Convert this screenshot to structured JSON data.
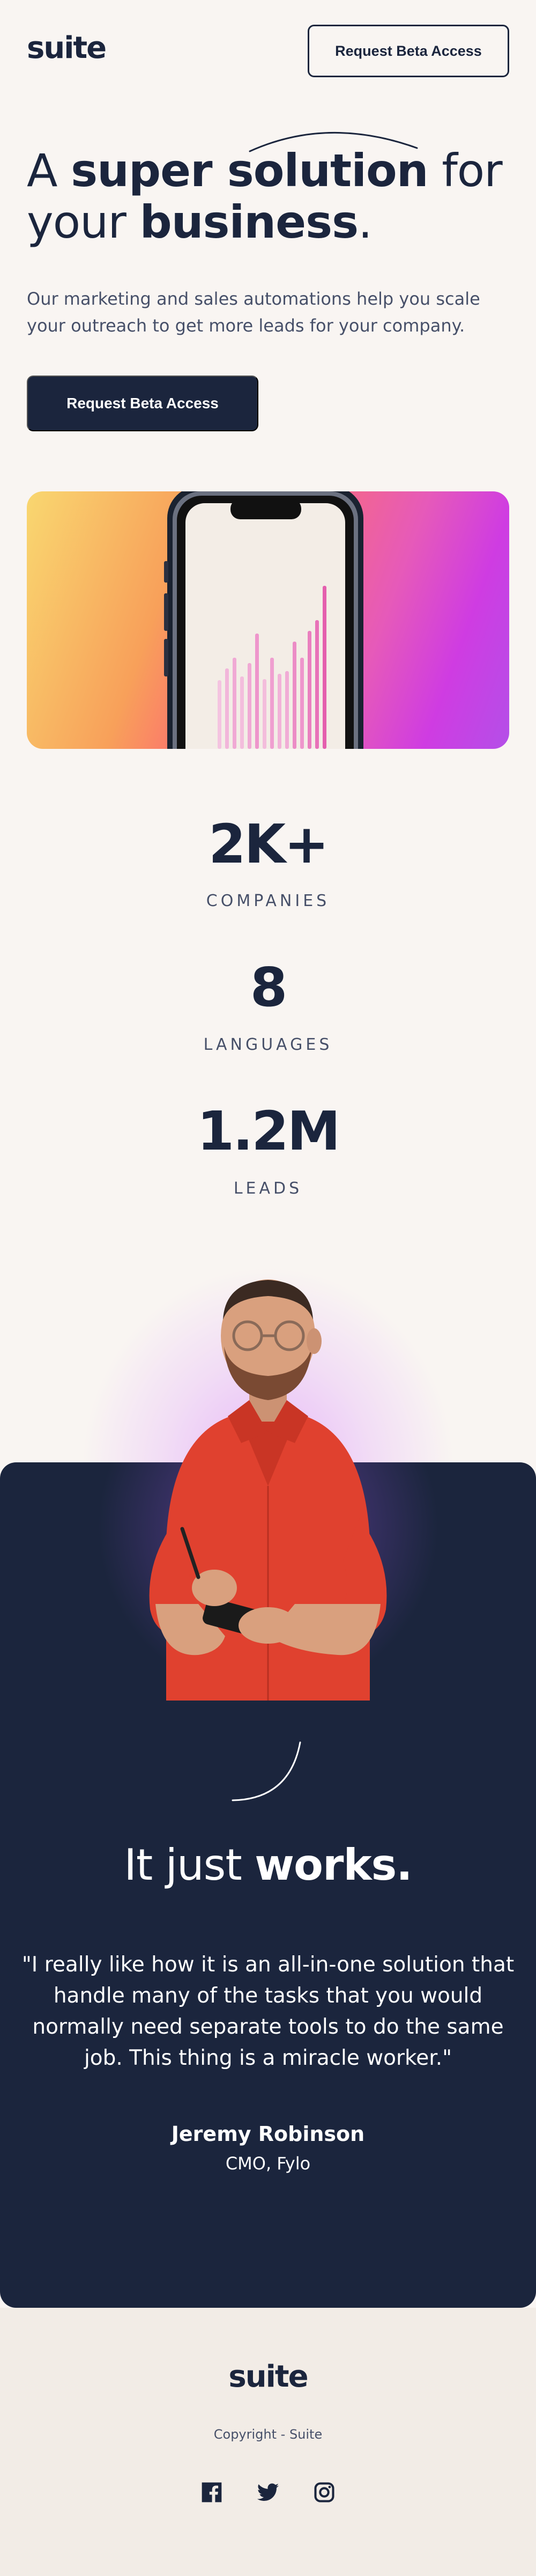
{
  "header": {
    "logo": "suite",
    "cta_label": "Request Beta Access"
  },
  "hero": {
    "title_part1": "A ",
    "title_bold1": "super solution",
    "title_part2": " for your ",
    "title_bold2": "business",
    "title_part3": ".",
    "subtitle": "Our marketing and sales automations help you scale your outreach to get more leads for your company.",
    "cta_label": "Request Beta Access"
  },
  "stats": [
    {
      "value": "2K+",
      "label": "COMPANIES"
    },
    {
      "value": "8",
      "label": "LANGUAGES"
    },
    {
      "value": "1.2M",
      "label": "LEADS"
    }
  ],
  "testimonial": {
    "heading_part1": "It just ",
    "heading_bold": "works.",
    "quote": "\"I really like how it is an all-in-one solution that handle many of the tasks that you would normally need separate tools to do the same job. This thing is a miracle worker.\"",
    "author": "Jeremy Robinson",
    "role": "CMO, Fylo"
  },
  "footer": {
    "logo": "suite",
    "copyright": "Copyright - Suite",
    "social_icons": [
      "facebook-icon",
      "twitter-icon",
      "instagram-icon"
    ]
  },
  "colors": {
    "navy": "#1b253d",
    "background": "#f9f5f2",
    "footer_background": "#f2ece6",
    "accent_pink": "#f07cc5"
  }
}
